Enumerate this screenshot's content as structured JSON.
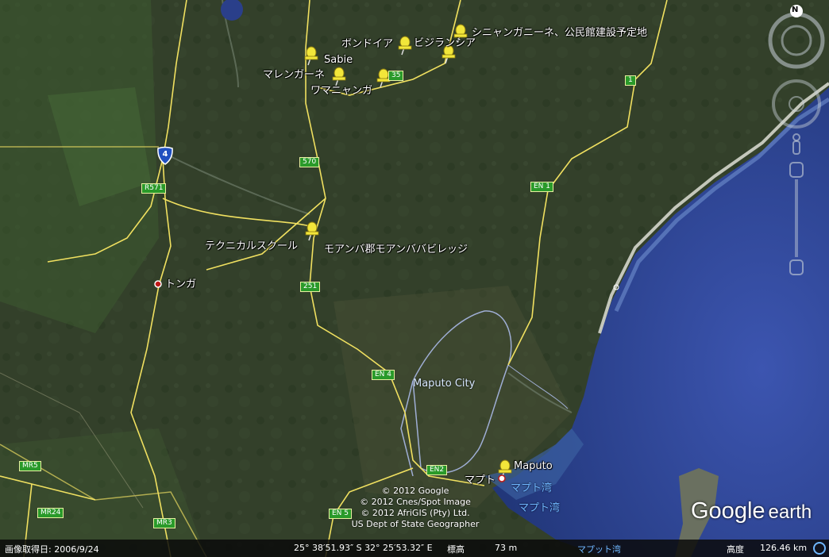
{
  "map": {
    "labels": [
      {
        "id": "bondoia",
        "text": "ボンドイア"
      },
      {
        "id": "bijiranshia",
        "text": "ビジランシア"
      },
      {
        "id": "shinyangani",
        "text": "シニャンガニーネ、公民館建設予定地"
      },
      {
        "id": "sabie",
        "text": "Sabie"
      },
      {
        "id": "marengane",
        "text": "マレンガーネ"
      },
      {
        "id": "wamanyanga",
        "text": "ワマニャンガ"
      },
      {
        "id": "tekunikaru",
        "text": "テクニカルスクール"
      },
      {
        "id": "moamba",
        "text": "モアンバ郡モアンババビレッジ"
      },
      {
        "id": "tonga",
        "text": "トンガ"
      },
      {
        "id": "maputo",
        "text": "Maputo"
      },
      {
        "id": "maputo_jp",
        "text": "マプト"
      }
    ],
    "city_label": "Maputo City",
    "water_labels": [
      "マプト湾",
      "マプト湾"
    ],
    "roads": [
      {
        "id": "r1",
        "text": "1"
      },
      {
        "id": "r570",
        "text": "570"
      },
      {
        "id": "r571",
        "text": "R571"
      },
      {
        "id": "en1",
        "text": "EN 1"
      },
      {
        "id": "r251",
        "text": "251"
      },
      {
        "id": "en4",
        "text": "EN 4"
      },
      {
        "id": "en2",
        "text": "EN2"
      },
      {
        "id": "en5",
        "text": "EN 5"
      },
      {
        "id": "mr5",
        "text": "MR5"
      },
      {
        "id": "mr24",
        "text": "MR24"
      },
      {
        "id": "mr3",
        "text": "MR3"
      },
      {
        "id": "r35",
        "text": "35"
      },
      {
        "id": "n4",
        "text": "4"
      }
    ],
    "copyright": [
      "© 2012 Google",
      "© 2012 Cnes/Spot Image",
      "© 2012 AfriGIS (Pty) Ltd.",
      "US Dept of State Geographer"
    ]
  },
  "status": {
    "imagery_date": "画像取得日: 2006/9/24",
    "coordinates": "25° 38′51.93″ S  32° 25′53.32″ E",
    "elevation_label": "標高",
    "elevation_value": "73 m",
    "altitude_label": "高度",
    "altitude_value": "126.46 km",
    "partial_label": "マプット湾"
  },
  "logo": {
    "google": "Google",
    "earth": "earth"
  },
  "compass": {
    "north": "N"
  },
  "colors": {
    "pin": "#f2e63a",
    "road": "#e8e060",
    "shield": "#2a9a2a",
    "water": "#2a3f8a",
    "water_label": "#6fb7ff"
  }
}
